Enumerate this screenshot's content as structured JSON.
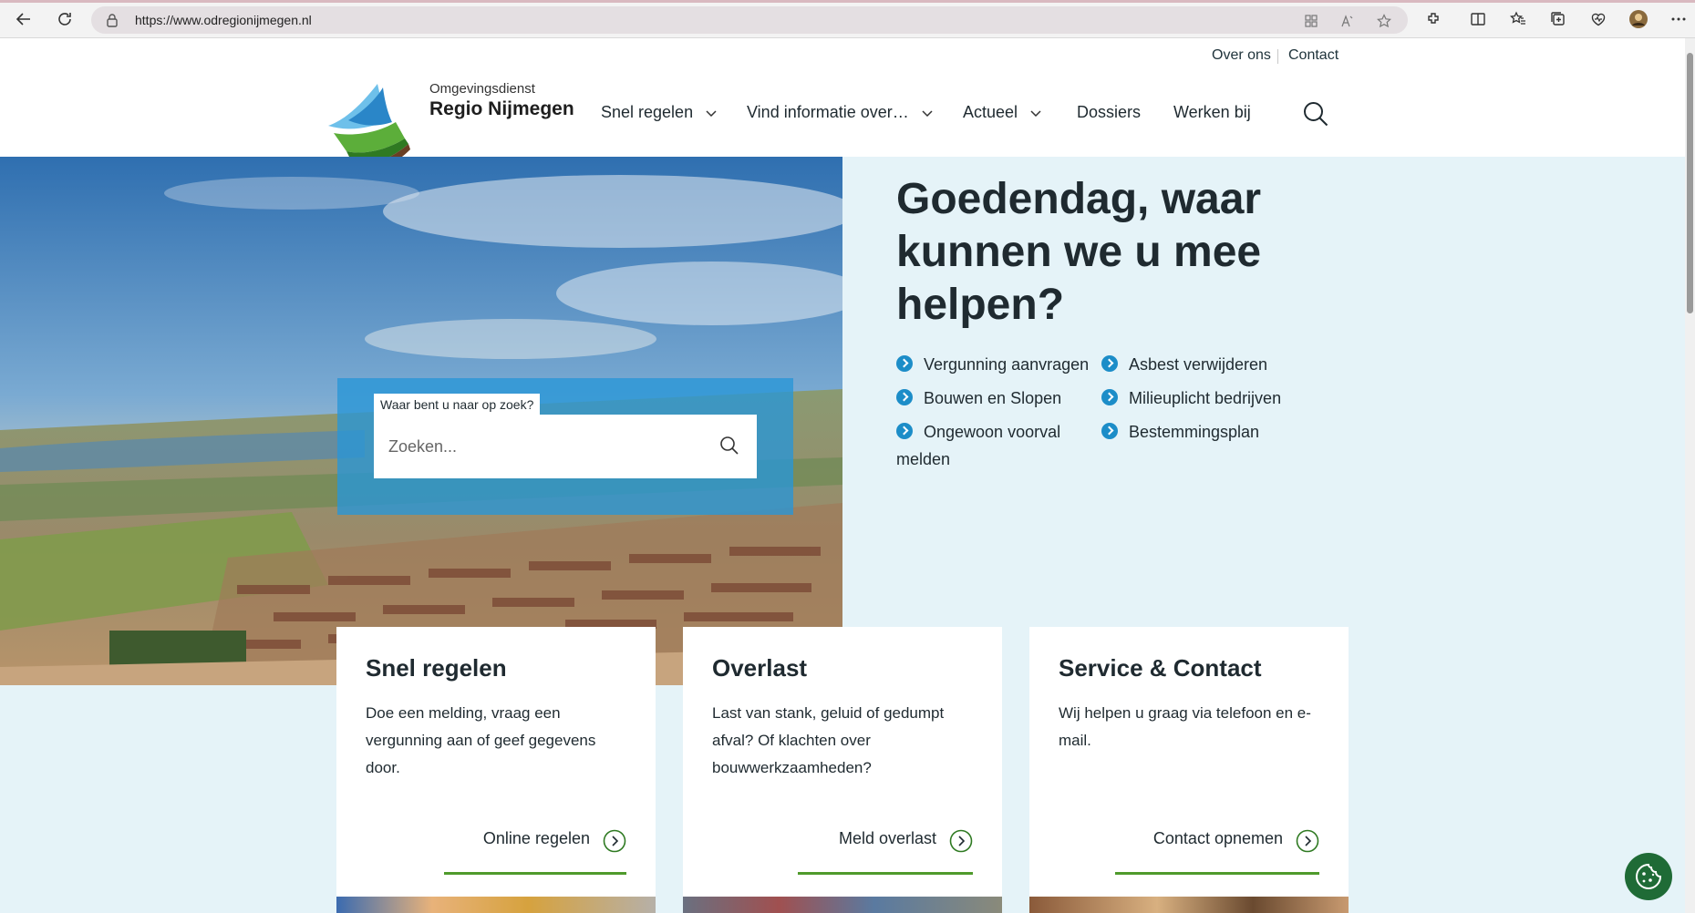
{
  "browser": {
    "url": "https://www.odregionijmegen.nl",
    "icons": [
      "back-icon",
      "refresh-icon",
      "lock-icon",
      "reader-icon",
      "read-aloud-icon",
      "favorite-icon",
      "extensions-icon",
      "split-screen-icon",
      "favorites-icon",
      "collections-icon",
      "browser-essentials-icon",
      "profile-icon",
      "more-icon"
    ]
  },
  "header": {
    "util_links": [
      "Over ons",
      "Contact"
    ],
    "logo_small": "Omgevingsdienst",
    "logo_big": "Regio Nijmegen",
    "nav": [
      "Snel regelen",
      "Vind informatie over…",
      "Actueel",
      "Dossiers",
      "Werken bij"
    ]
  },
  "hero": {
    "search_label": "Waar bent u naar op zoek?",
    "search_placeholder": "Zoeken...",
    "title": "Goedendag, waar kunnen we u mee helpen?",
    "quick_links": [
      "Vergunning aanvragen",
      "Asbest verwijderen",
      "Bouwen en Slopen",
      "Milieuplicht bedrijven",
      "Ongewoon voorval melden",
      "Bestemmingsplan"
    ]
  },
  "cards": [
    {
      "title": "Snel regelen",
      "text": "Doe een melding, vraag een vergunning aan of geef gegevens door.",
      "cta": "Online regelen"
    },
    {
      "title": "Overlast",
      "text": "Last van stank, geluid of gedumpt afval? Of klachten over bouwwerkzaamheden?",
      "cta": "Meld overlast"
    },
    {
      "title": "Service & Contact",
      "text": "Wij helpen u graag via telefoon en e-mail.",
      "cta": "Contact opnemen"
    }
  ],
  "colors": {
    "accent_blue": "#1c8dc8",
    "accent_green": "#4f9a2c",
    "hero_bg": "#e5f3f8",
    "cookie_green": "#1f6b36"
  }
}
